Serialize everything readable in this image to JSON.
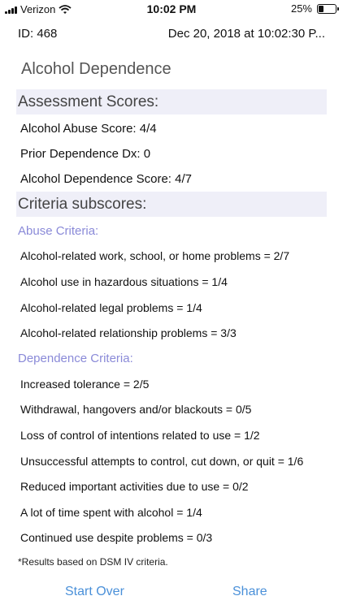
{
  "status_bar": {
    "carrier": "Verizon",
    "time": "10:02 PM",
    "battery": "25%",
    "battery_level": 0.25
  },
  "record": {
    "id": "ID: 468",
    "datetime": "Dec 20, 2018 at 10:02:30 P..."
  },
  "title": "Alcohol Dependence",
  "assessment": {
    "header": "Assessment Scores:",
    "rows": [
      "Alcohol Abuse Score: 4/4",
      "Prior Dependence Dx: 0",
      "Alcohol Dependence Score: 4/7"
    ]
  },
  "criteria": {
    "header": "Criteria subscores:",
    "abuse_label": "Abuse Criteria:",
    "abuse_rows": [
      "Alcohol-related work, school, or home problems = 2/7",
      "Alcohol use in hazardous situations = 1/4",
      "Alcohol-related legal problems = 1/4",
      "Alcohol-related relationship problems = 3/3"
    ],
    "dependence_label": "Dependence Criteria:",
    "dependence_rows": [
      "Increased tolerance = 2/5",
      "Withdrawal, hangovers and/or blackouts = 0/5",
      "Loss of control of intentions related to use = 1/2",
      "Unsuccessful attempts to control, cut down, or quit = 1/6",
      "Reduced important activities due to use = 0/2",
      "A lot of time spent with alcohol = 1/4",
      "Continued use despite problems = 0/3"
    ]
  },
  "footnote": "*Results based on DSM IV criteria.",
  "buttons": {
    "start_over": "Start Over",
    "share": "Share"
  },
  "colors": {
    "section_bg": "#efeff8",
    "subheader": "#8a8ad8",
    "link": "#4a90d9"
  },
  "icons": [
    "signal-icon",
    "wifi-icon",
    "battery-icon"
  ]
}
